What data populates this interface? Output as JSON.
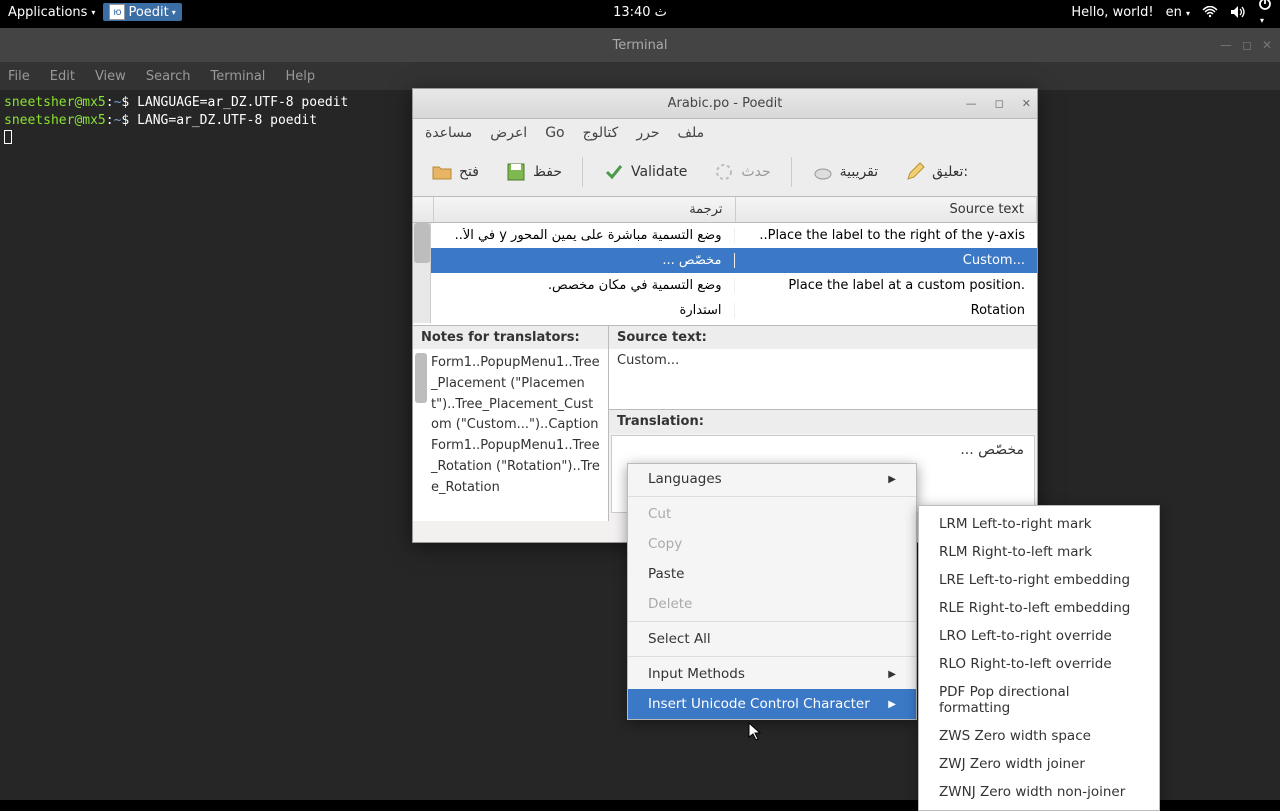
{
  "top_panel": {
    "applications": "Applications",
    "poedit": "Poedit",
    "clock": "13:40 ث",
    "hello": "Hello, world!",
    "lang": "en"
  },
  "terminal": {
    "title": "Terminal",
    "menu": {
      "file": "File",
      "edit": "Edit",
      "view": "View",
      "search": "Search",
      "terminal": "Terminal",
      "help": "Help"
    },
    "line1_prompt": "sneetsher@mx5",
    "line1_path": "~",
    "line1_cmd": "LANGUAGE=ar_DZ.UTF-8 poedit",
    "line2_cmd": "LANG=ar_DZ.UTF-8 poedit"
  },
  "poedit": {
    "title": "Arabic.po - Poedit",
    "menu": {
      "file": "ملف",
      "edit": "حرر",
      "catalog": "كتالوج",
      "go": "Go",
      "view": "اعرض",
      "help": "مساعدة"
    },
    "toolbar": {
      "open": "فتح",
      "save": "حفظ",
      "validate": "Validate",
      "update": "حدث",
      "fuzzy": "تقريبية",
      "comment": "تعليق:"
    },
    "headers": {
      "source": "Source text",
      "translation": "ترجمة"
    },
    "rows": [
      {
        "src": "..Place the label to the right of the y-axis",
        "trans": "وضع التسمية مباشرة على يمين المحور y في الأ.."
      },
      {
        "src": "Custom...",
        "trans": "مخصّص ..."
      },
      {
        "src": "Place the label at a custom position.",
        "trans": "وضع التسمية في مكان مخصص."
      },
      {
        "src": "Rotation",
        "trans": "استدارة"
      }
    ],
    "labels": {
      "notes": "Notes for translators:",
      "source": "Source text:",
      "translation": "Translation:"
    },
    "notes_text": "Form1..PopupMenu1..Tree_Placement (\"Placement\")..Tree_Placement_Custom (\"Custom...\")..Caption Form1..PopupMenu1..Tree_Rotation (\"Rotation\")..Tree_Rotation",
    "source_text": "Custom...",
    "translation_text": "مخصّص ..."
  },
  "ctx_menu": {
    "languages": "Languages",
    "cut": "Cut",
    "copy": "Copy",
    "paste": "Paste",
    "delete": "Delete",
    "select_all": "Select All",
    "input_methods": "Input Methods",
    "insert_unicode": "Insert Unicode Control Character"
  },
  "sub_menu": [
    "LRM Left-to-right mark",
    "RLM Right-to-left mark",
    "LRE Left-to-right embedding",
    "RLE Right-to-left embedding",
    "LRO Left-to-right override",
    "RLO Right-to-left override",
    "PDF Pop directional formatting",
    "ZWS Zero width space",
    "ZWJ Zero width joiner",
    "ZWNJ Zero width non-joiner"
  ]
}
